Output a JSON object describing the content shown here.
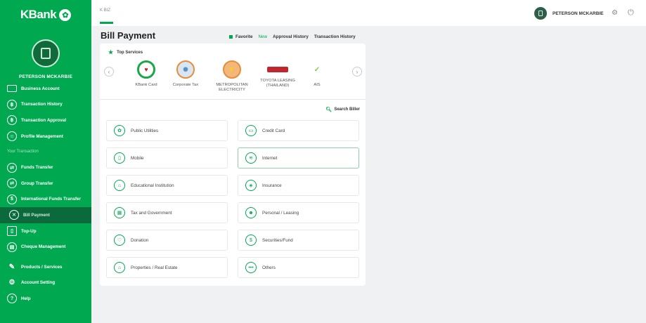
{
  "brand": {
    "name": "KBank",
    "logo_icon": "kbank-logo"
  },
  "sidebar": {
    "profile_name": "PETERSON MCKARBIE",
    "items_top": [
      {
        "label": "Business Account",
        "icon": "briefcase-icon"
      },
      {
        "label": "Transaction History",
        "icon": "history-icon"
      },
      {
        "label": "Transaction Approval",
        "icon": "approval-icon"
      },
      {
        "label": "Profile Management",
        "icon": "profile-icon"
      }
    ],
    "section_label": "Your Transaction",
    "items_transaction": [
      {
        "label": "Funds Transfer",
        "icon": "transfer-icon"
      },
      {
        "label": "Group Transfer",
        "icon": "group-transfer-icon"
      },
      {
        "label": "International Funds Transfer",
        "icon": "international-icon"
      },
      {
        "label": "Bill Payment",
        "icon": "bill-icon",
        "active": true
      },
      {
        "label": "Top-Up",
        "icon": "topup-icon"
      },
      {
        "label": "Cheque Management",
        "icon": "cheque-icon"
      }
    ],
    "items_bottom": [
      {
        "label": "Products / Services",
        "icon": "pen-icon"
      },
      {
        "label": "Account Setting",
        "icon": "gear-icon"
      },
      {
        "label": "Help",
        "icon": "help-icon"
      }
    ]
  },
  "topbar": {
    "breadcrumb": "K BIZ",
    "user_name": "PETERSON MCKARBIE"
  },
  "page": {
    "title": "Bill Payment",
    "tabs": [
      "Favorite",
      "New",
      "Approval History",
      "Transaction History"
    ]
  },
  "top_services": {
    "heading": "Top Services",
    "items": [
      {
        "label": "KBank Card",
        "color": "#1aa74a"
      },
      {
        "label": "Corporate Tax",
        "color": "#5a8fc2"
      },
      {
        "label": "METROPOLITAN ELECTRICITY",
        "color": "#e98c3a"
      },
      {
        "label": "TOYOTA LEASING (THAILAND)",
        "color": "#c0272d"
      },
      {
        "label": "AIS",
        "color": "#8cc63f"
      }
    ]
  },
  "search_biller": "Search Biller",
  "categories": [
    {
      "label": "Public Utilities",
      "icon": "utilities-icon"
    },
    {
      "label": "Credit Card",
      "icon": "credit-card-icon"
    },
    {
      "label": "Mobile",
      "icon": "mobile-icon"
    },
    {
      "label": "Internet",
      "icon": "wifi-icon",
      "selected": true
    },
    {
      "label": "Educational Institution",
      "icon": "education-icon"
    },
    {
      "label": "Insurance",
      "icon": "insurance-icon"
    },
    {
      "label": "Tax and Government",
      "icon": "tax-icon"
    },
    {
      "label": "Personal / Leasing",
      "icon": "leasing-icon"
    },
    {
      "label": "Donation",
      "icon": "donation-icon"
    },
    {
      "label": "Securities/Fund",
      "icon": "securities-icon"
    },
    {
      "label": "Properties / Real Estate",
      "icon": "property-icon"
    },
    {
      "label": "Others",
      "icon": "others-icon"
    }
  ]
}
